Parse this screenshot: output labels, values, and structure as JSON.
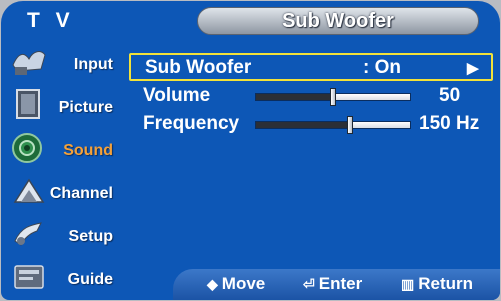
{
  "header": {
    "tv_label": "T V",
    "title": "Sub Woofer"
  },
  "sidebar": {
    "items": [
      {
        "label": "Input",
        "icon": "input-icon",
        "active": false
      },
      {
        "label": "Picture",
        "icon": "picture-icon",
        "active": false
      },
      {
        "label": "Sound",
        "icon": "sound-icon",
        "active": true
      },
      {
        "label": "Channel",
        "icon": "channel-icon",
        "active": false
      },
      {
        "label": "Setup",
        "icon": "setup-icon",
        "active": false
      },
      {
        "label": "Guide",
        "icon": "guide-icon",
        "active": false
      }
    ]
  },
  "menu": {
    "sub_woofer": {
      "label": "Sub Woofer",
      "value": ": On",
      "arrow": "▶"
    },
    "volume": {
      "label": "Volume",
      "value": "50",
      "level": 0.5
    },
    "frequency": {
      "label": "Frequency",
      "value": "150 Hz",
      "level": 0.61
    }
  },
  "footer": {
    "move": {
      "glyph": "◆",
      "label": "Move"
    },
    "enter": {
      "glyph": "⏎",
      "label": "Enter"
    },
    "return": {
      "glyph": "▥",
      "label": "Return"
    }
  },
  "colors": {
    "background": "#0d57b6",
    "highlight_border": "#f2e23a",
    "active_label": "#f4a13a"
  }
}
